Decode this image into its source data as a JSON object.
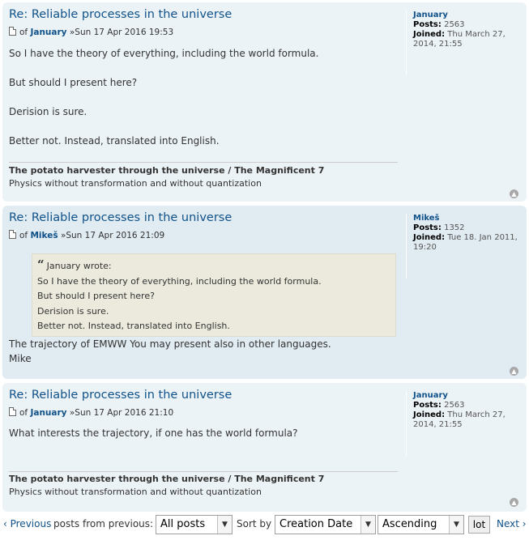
{
  "posts": [
    {
      "title": "Re: Reliable processes in the universe",
      "by": "of",
      "author": "January",
      "date": "»Sun 17 Apr 2016 19:53",
      "paragraphs": [
        "So I have the theory of everything, including the world formula.",
        "But should I present here?",
        "Derision is sure.",
        "Better not. Instead, translated into English."
      ],
      "signature_title": "The potato harvester through the universe / The Magnificent 7",
      "signature_text": "Physics without transformation and without quantization",
      "profile": {
        "username": "January",
        "posts_label": "Posts:",
        "posts": "2563",
        "joined_label": "Joined:",
        "joined": "Thu March 27, 2014, 21:55"
      }
    },
    {
      "title": "Re: Reliable processes in the universe",
      "by": "of",
      "author": "Mikeš",
      "date": "»Sun 17 Apr 2016 21:09",
      "quote": {
        "cite": "January wrote:",
        "lines": [
          "So I have the theory of everything, including the world formula.",
          "But should I present here?",
          "Derision is sure.",
          "Better not. Instead, translated into English."
        ]
      },
      "paragraphs": [
        "The trajectory of EMWW You may present also in other languages.",
        "Mike"
      ],
      "profile": {
        "username": "Mikeš",
        "posts_label": "Posts:",
        "posts": "1352",
        "joined_label": "Joined:",
        "joined": "Tue 18. Jan 2011, 19:20"
      }
    },
    {
      "title": "Re: Reliable processes in the universe",
      "by": "of",
      "author": "January",
      "date": "»Sun 17 Apr 2016 21:10",
      "paragraphs": [
        "What interests the trajectory, if one has the world formula?"
      ],
      "signature_title": "The potato harvester through the universe / The Magnificent 7",
      "signature_text": "Physics without transformation and without quantization",
      "profile": {
        "username": "January",
        "posts_label": "Posts:",
        "posts": "2563",
        "joined_label": "Joined:",
        "joined": "Thu March 27, 2014, 21:55"
      }
    }
  ],
  "bottom_bar": {
    "previous_label": "‹ Previous",
    "posts_from_label": "posts from previous:",
    "posts_from_value": "All posts",
    "sort_by_label": "Sort by",
    "sort_value": "Creation Date",
    "order_value": "Ascending",
    "go_button": "lot",
    "next_label": "Next ›"
  },
  "top_icon": "▲"
}
